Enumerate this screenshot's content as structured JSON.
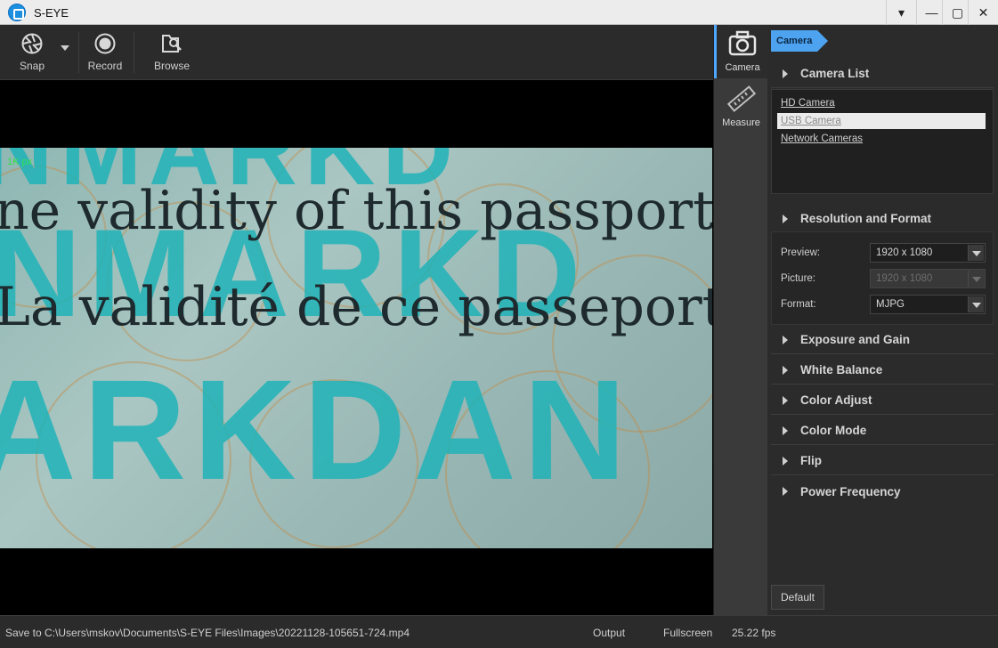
{
  "window": {
    "title": "S-EYE",
    "controls": {
      "menu": "▾",
      "minimize": "—",
      "maximize": "▢",
      "close": "✕"
    }
  },
  "toolbar": {
    "snap_label": "Snap",
    "record_label": "Record",
    "browse_label": "Browse"
  },
  "viewer": {
    "scale_label": "1K px",
    "line1": "ne validity of this passport",
    "line2": "La validité de ce passeport",
    "background_letters_top": "NMARKD",
    "background_letters_bottom": "ARKDAN"
  },
  "side_tabs": {
    "camera_label": "Camera",
    "measure_label": "Measure"
  },
  "panel": {
    "breadcrumb": "Camera",
    "sections": {
      "camera_list": "Camera List",
      "resolution": "Resolution and Format",
      "exposure": "Exposure and Gain",
      "white_balance": "White Balance",
      "color_adjust": "Color Adjust",
      "color_mode": "Color Mode",
      "flip": "Flip",
      "power_frequency": "Power Frequency"
    },
    "cameras": [
      "HD Camera",
      "USB Camera",
      "Network Cameras"
    ],
    "selected_camera_index": 1,
    "form": {
      "preview_label": "Preview:",
      "preview_value": "1920 x 1080",
      "picture_label": "Picture:",
      "picture_value": "1920 x 1080",
      "format_label": "Format:",
      "format_value": "MJPG"
    },
    "default_button": "Default"
  },
  "status": {
    "save_path": "Save to C:\\Users\\mskov\\Documents\\S-EYE Files\\Images\\20221128-105651-724.mp4",
    "output": "Output",
    "fullscreen": "Fullscreen",
    "fps": "25.22 fps"
  },
  "colors": {
    "accent": "#4da3f0",
    "watermark_cyan": "#20b3b8",
    "panel_bg": "#2b2b2b"
  }
}
